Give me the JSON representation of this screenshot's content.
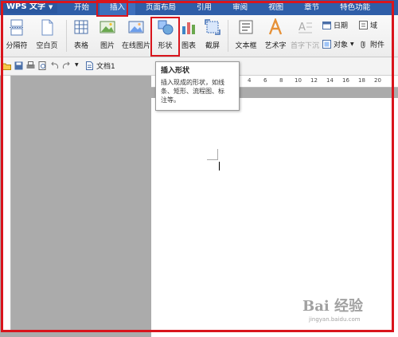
{
  "app": {
    "name": "WPS 文字"
  },
  "menu": [
    {
      "label": "开始"
    },
    {
      "label": "插入"
    },
    {
      "label": "页面布局"
    },
    {
      "label": "引用"
    },
    {
      "label": "审阅"
    },
    {
      "label": "视图"
    },
    {
      "label": "章节"
    },
    {
      "label": "特色功能"
    }
  ],
  "ribbon": {
    "page_break": "分隔符",
    "blank_page": "空白页",
    "table": "表格",
    "picture": "图片",
    "online_picture": "在线图片",
    "shape": "形状",
    "chart": "图表",
    "screenshot": "截屏",
    "textbox": "文本框",
    "wordart": "艺术字",
    "dropcap": "首字下沉",
    "date": "日期",
    "field": "域",
    "object": "对象",
    "attachment": "附件"
  },
  "document": {
    "tab_name": "文档1"
  },
  "ruler": {
    "marks": [
      "4",
      "6",
      "8",
      "10",
      "12",
      "14",
      "16",
      "18",
      "20"
    ]
  },
  "tooltip": {
    "title": "插入形状",
    "line1": "插入现成的形状，如线",
    "line2": "条、矩形、流程图、标",
    "line3": "注等。"
  },
  "watermark": {
    "brand": "Bai 经验",
    "url": "jingyan.baidu.com"
  },
  "colors": {
    "title_bar": "#2f5ea8",
    "highlight": "#d9141c"
  }
}
